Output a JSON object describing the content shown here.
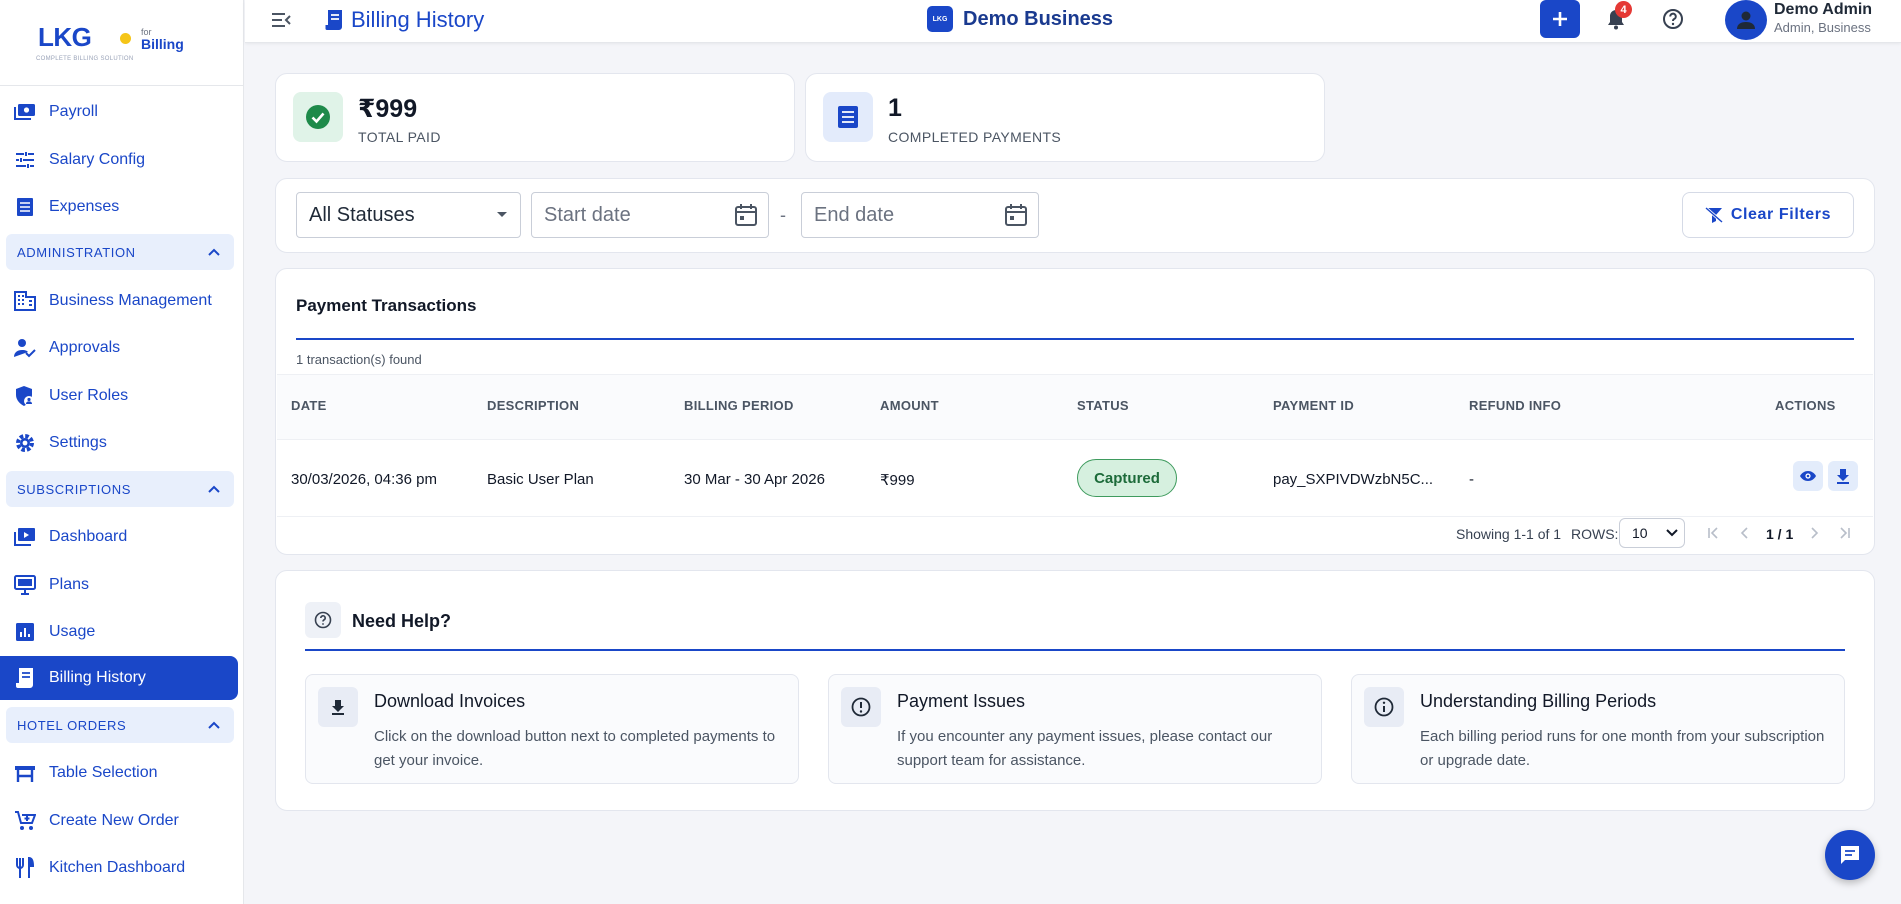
{
  "brand": {
    "logo_text": "LKG",
    "tagline": "COMPLETE BILLING SOLUTION",
    "for_text": "for",
    "product": "Billing"
  },
  "sidebar": {
    "items_top": [
      {
        "label": "Payroll",
        "icon": "payroll-icon"
      },
      {
        "label": "Salary Config",
        "icon": "sliders-icon"
      },
      {
        "label": "Expenses",
        "icon": "receipt-icon"
      }
    ],
    "sections": [
      {
        "label": "ADMINISTRATION",
        "items": [
          {
            "label": "Business Management",
            "icon": "building-icon"
          },
          {
            "label": "Approvals",
            "icon": "user-check-icon"
          },
          {
            "label": "User Roles",
            "icon": "shield-user-icon"
          },
          {
            "label": "Settings",
            "icon": "gear-icon"
          }
        ]
      },
      {
        "label": "SUBSCRIPTIONS",
        "items": [
          {
            "label": "Dashboard",
            "icon": "dashboard-icon"
          },
          {
            "label": "Plans",
            "icon": "monitor-icon"
          },
          {
            "label": "Usage",
            "icon": "bar-chart-icon"
          },
          {
            "label": "Billing History",
            "icon": "receipt-long-icon",
            "active": true
          }
        ]
      },
      {
        "label": "HOTEL ORDERS",
        "items": [
          {
            "label": "Table Selection",
            "icon": "table-icon"
          },
          {
            "label": "Create New Order",
            "icon": "cart-plus-icon"
          },
          {
            "label": "Kitchen Dashboard",
            "icon": "utensils-icon"
          }
        ]
      }
    ]
  },
  "header": {
    "page_title": "Billing History",
    "business_logo_text": "LKG",
    "business_name": "Demo Business",
    "notification_count": "4",
    "user_name": "Demo Admin",
    "user_role": "Admin, Business"
  },
  "stats": {
    "total_paid_value": "₹999",
    "total_paid_label": "TOTAL PAID",
    "completed_value": "1",
    "completed_label": "COMPLETED PAYMENTS"
  },
  "filters": {
    "status_selected": "All Statuses",
    "start_placeholder": "Start date",
    "separator": "-",
    "end_placeholder": "End date",
    "clear_label": "Clear Filters"
  },
  "transactions": {
    "title": "Payment Transactions",
    "count_text": "1 transaction(s) found",
    "columns": [
      "DATE",
      "DESCRIPTION",
      "BILLING PERIOD",
      "AMOUNT",
      "STATUS",
      "PAYMENT ID",
      "REFUND INFO",
      "ACTIONS"
    ],
    "rows": [
      {
        "date": "30/03/2026, 04:36 pm",
        "description": "Basic User Plan",
        "billing_period": "30 Mar - 30 Apr 2026",
        "amount": "₹999",
        "status": "Captured",
        "payment_id": "pay_SXPIVDWzbN5C...",
        "refund_info": "-"
      }
    ],
    "pagination": {
      "showing": "Showing 1-1 of 1",
      "rows_label": "ROWS:",
      "rows_value": "10",
      "page_text": "1 / 1"
    }
  },
  "help": {
    "title": "Need Help?",
    "cards": [
      {
        "title": "Download Invoices",
        "desc": "Click on the download button next to completed payments to get your invoice.",
        "icon": "download-icon"
      },
      {
        "title": "Payment Issues",
        "desc": "If you encounter any payment issues, please contact our support team for assistance.",
        "icon": "alert-circle-icon"
      },
      {
        "title": "Understanding Billing Periods",
        "desc": "Each billing period runs for one month from your subscription or upgrade date.",
        "icon": "info-icon"
      }
    ]
  },
  "colors": {
    "primary": "#1a47c8",
    "success_bg": "#d6f0df",
    "success_text": "#1d6b3a",
    "badge": "#e53935"
  }
}
